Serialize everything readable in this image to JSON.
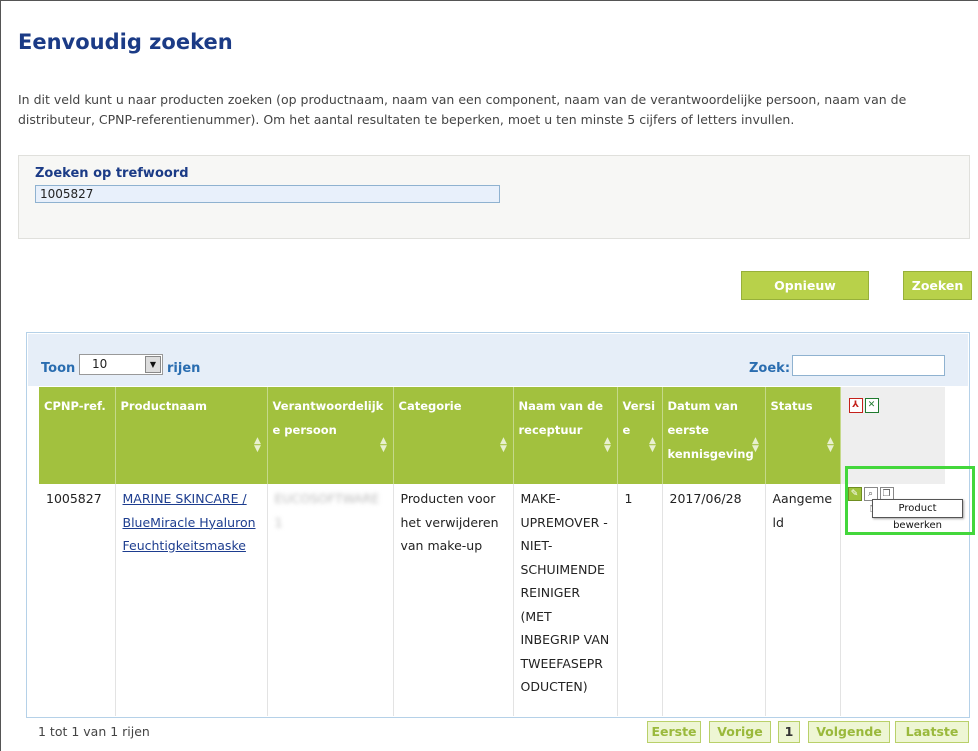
{
  "page": {
    "title": "Eenvoudig zoeken",
    "intro": "In dit veld kunt u naar producten zoeken (op productnaam, naam van een component, naam van de verantwoordelijke persoon, naam van de distributeur, CPNP-referentienummer). Om het aantal resultaten te beperken, moet u ten minste 5 cijfers of letters invullen."
  },
  "search": {
    "label": "Zoeken op trefwoord",
    "value": "1005827"
  },
  "buttons": {
    "reset": "Opnieuw invoeren",
    "search": "Zoeken"
  },
  "table_controls": {
    "show_label": "Toon",
    "page_length": "10",
    "rows_label": "rijen",
    "filter_label": "Zoek:",
    "filter_value": ""
  },
  "table": {
    "columns": [
      "CPNP-ref.",
      "Productnaam",
      "Verantwoordelijke persoon",
      "Categorie",
      "Naam van de receptuur",
      "Versie",
      "Datum van eerste kennisgeving",
      "Status",
      ""
    ],
    "rows": [
      {
        "ref": "1005827",
        "product": "MARINE SKINCARE / BlueMiracle Hyaluron Feuchtigkeitsmaske",
        "person": "EUCOSOFTWARE 1",
        "category": "Producten voor het verwijderen van make-up",
        "formulation": "MAKE-UPREMOVER - NIET-SCHUIMENDE REINIGER (MET INBEGRIP VAN TWEEFASEPRODUCTEN)",
        "version": "1",
        "date": "2017/06/28",
        "status": "Aangemeld"
      }
    ]
  },
  "tooltip": "Product bewerken",
  "footer": {
    "count": "1 tot 1 van 1 rijen",
    "first": "Eerste",
    "prev": "Vorige",
    "page": "1",
    "next": "Volgende",
    "last": "Laatste"
  },
  "icons": {
    "export_pdf": "pdf-icon",
    "export_xls": "excel-icon",
    "edit": "pencil-icon",
    "view": "magnifier-icon",
    "copy": "copy-icon",
    "cursor": "hand-cursor-icon"
  },
  "colors": {
    "title": "#1b3b86",
    "header_green": "#a2c13e",
    "button_green": "#b8d14a",
    "highlight": "#43d73b"
  }
}
